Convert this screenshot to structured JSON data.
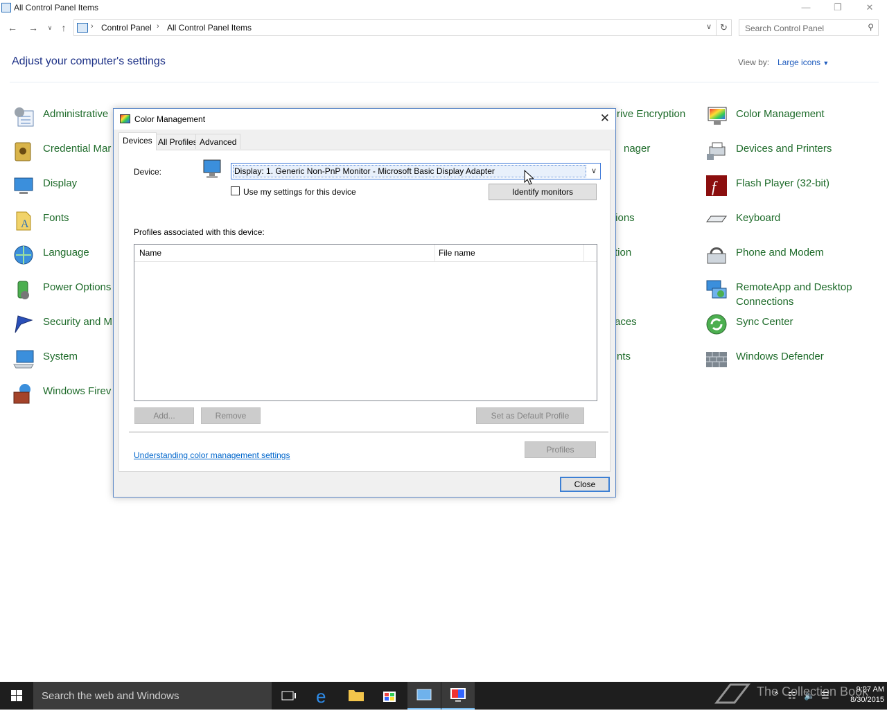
{
  "window": {
    "title": "All Control Panel Items",
    "minimize_icon": "minimize-icon",
    "restore_icon": "restore-icon",
    "close_icon": "close-icon"
  },
  "address_bar": {
    "breadcrumbs": [
      "Control Panel",
      "All Control Panel Items"
    ],
    "search_placeholder": "Search Control Panel"
  },
  "header": {
    "title": "Adjust your computer's settings",
    "view_by_label": "View by:",
    "view_by_value": "Large icons"
  },
  "items": {
    "col1": [
      {
        "label": "Administrative",
        "icon": "admin-tools-icon"
      },
      {
        "label": "Credential Mar",
        "icon": "credential-manager-icon"
      },
      {
        "label": "Display",
        "icon": "display-icon"
      },
      {
        "label": "Fonts",
        "icon": "fonts-icon"
      },
      {
        "label": "Language",
        "icon": "language-icon"
      },
      {
        "label": "Power Options",
        "icon": "power-options-icon"
      },
      {
        "label": "Security and M",
        "icon": "security-flag-icon"
      },
      {
        "label": "System",
        "icon": "system-icon"
      },
      {
        "label": "Windows Firev",
        "icon": "firewall-icon"
      }
    ],
    "col3": [
      {
        "label": "rive Encryption"
      },
      {
        "label": "nager"
      },
      {
        "label": "tions"
      },
      {
        "label": "tion"
      },
      {
        "label": "aces"
      },
      {
        "label": "nts"
      }
    ],
    "col4": [
      {
        "label": "Color Management",
        "icon": "color-management-icon"
      },
      {
        "label": "Devices and Printers",
        "icon": "devices-printers-icon"
      },
      {
        "label": "Flash Player (32-bit)",
        "icon": "flash-icon"
      },
      {
        "label": "Keyboard",
        "icon": "keyboard-icon"
      },
      {
        "label": "Phone and Modem",
        "icon": "phone-modem-icon"
      },
      {
        "label": "RemoteApp and Desktop",
        "label2": "Connections",
        "icon": "remoteapp-icon"
      },
      {
        "label": "Sync Center",
        "icon": "sync-center-icon"
      },
      {
        "label": "Windows Defender",
        "icon": "windows-defender-icon"
      }
    ]
  },
  "dialog": {
    "title": "Color Management",
    "tabs": [
      "Devices",
      "All Profiles",
      "Advanced"
    ],
    "device_label": "Device:",
    "device_value": "Display: 1. Generic Non-PnP Monitor - Microsoft Basic Display Adapter",
    "use_settings_label": "Use my settings for this device",
    "identify_button": "Identify monitors",
    "profiles_label": "Profiles associated with this device:",
    "columns": [
      "Name",
      "File name"
    ],
    "add_button": "Add...",
    "remove_button": "Remove",
    "default_button": "Set as Default Profile",
    "help_link": "Understanding color management settings",
    "profiles_button": "Profiles",
    "close_button": "Close"
  },
  "taskbar": {
    "search_placeholder": "Search the web and Windows",
    "time": "9:27 AM",
    "date": "8/30/2015",
    "watermark": "The Collection Book"
  }
}
